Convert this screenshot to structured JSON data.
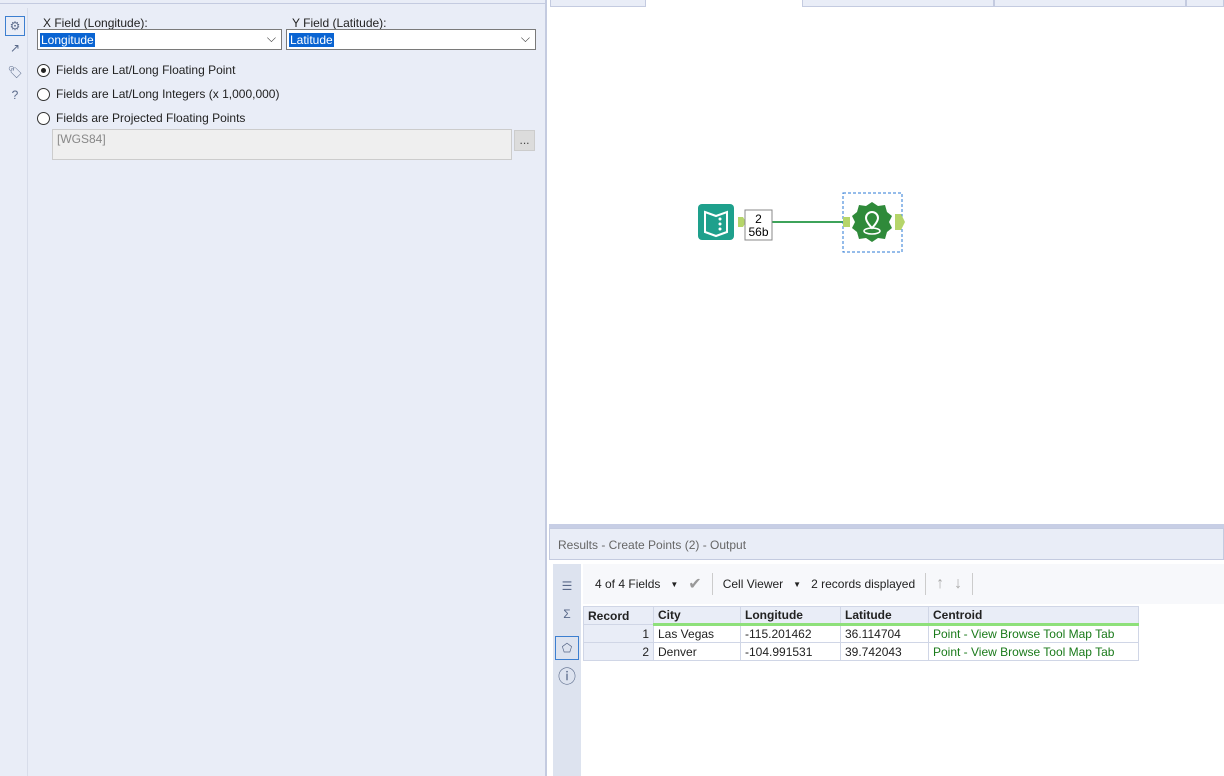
{
  "config": {
    "x_label": "X Field (Longitude):",
    "x_value": "Longitude",
    "y_label": "Y Field (Latitude):",
    "y_value": "Latitude",
    "options": [
      "Fields are Lat/Long Floating Point",
      "Fields are Lat/Long Integers (x 1,000,000)",
      "Fields are Projected Floating Points"
    ],
    "selected_option": 0,
    "projection": "[WGS84]",
    "projection_button": "..."
  },
  "workflow": {
    "record_count": "2",
    "size": "56b"
  },
  "results": {
    "title": "Results - Create Points (2) - Output",
    "fields": "4 of 4 Fields",
    "viewer": "Cell Viewer",
    "records": "2 records displayed",
    "columns": [
      "Record",
      "City",
      "Longitude",
      "Latitude",
      "Centroid"
    ],
    "rows": [
      [
        "1",
        "Las Vegas",
        "-115.201462",
        "36.114704",
        "Point - View Browse Tool Map Tab"
      ],
      [
        "2",
        "Denver",
        "-104.991531",
        "39.742043",
        "Point - View Browse Tool Map Tab"
      ]
    ]
  }
}
